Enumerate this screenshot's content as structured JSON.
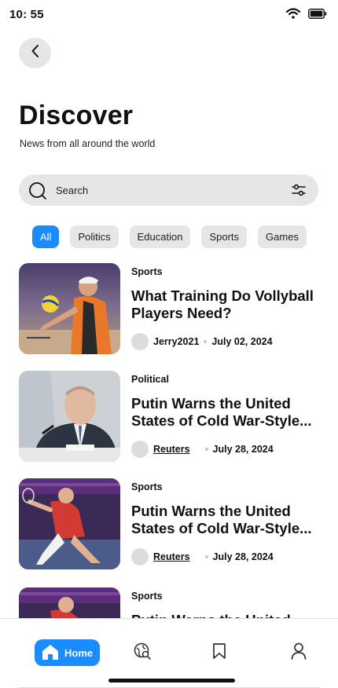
{
  "status": {
    "time": "10: 55"
  },
  "header": {
    "title": "Discover",
    "subtitle": "News from all around the world"
  },
  "search": {
    "placeholder": "Search"
  },
  "categories": [
    "All",
    "Politics",
    "Education",
    "Sports",
    "Games"
  ],
  "articles": [
    {
      "category": "Sports",
      "headline": "What Training Do Vollyball Players Need?",
      "author": "Jerry2021",
      "date": "July 02, 2024"
    },
    {
      "category": "Political",
      "headline": "Putin Warns the United States of Cold War-Style...",
      "author": "Reuters",
      "date": "July 28, 2024"
    },
    {
      "category": "Sports",
      "headline": "Putin Warns the United States of Cold War-Style...",
      "author": "Reuters",
      "date": "July 28, 2024"
    },
    {
      "category": "Sports",
      "headline": "Putin Warns the United"
    }
  ],
  "nav": {
    "home_label": "Home"
  },
  "colors": {
    "accent": "#1a8cff",
    "surface": "#e6e6e6"
  }
}
